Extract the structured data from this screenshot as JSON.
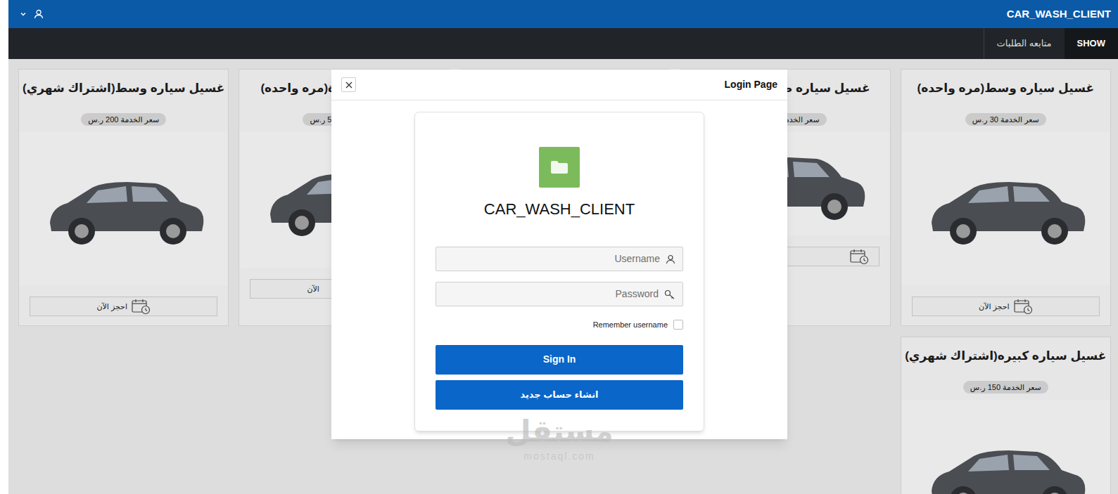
{
  "header": {
    "title": "CAR_WASH_CLIENT"
  },
  "nav": [
    {
      "label": "SHOW",
      "selected": true
    },
    {
      "label": "متابعه الطلبات",
      "selected": false
    }
  ],
  "services": [
    {
      "kind": "full",
      "title": "غسيل سياره وسط(مره واحده)",
      "price": "سعر الخدمة 30 ر.س",
      "button": "احجز الآن"
    },
    {
      "kind": "cut-left",
      "title": "غسيل سياره ص",
      "price": "سعر الخدمة"
    },
    {
      "kind": "hidden"
    },
    {
      "kind": "cut-right",
      "title": "ة(مره واحده)",
      "price": "5 ر.س",
      "button": "الآن"
    },
    {
      "kind": "full",
      "title": "غسيل سياره وسط(اشتراك شهري)",
      "price": "سعر الخدمة 200 ر.س",
      "button": "احجز الآن"
    },
    {
      "kind": "bottom",
      "title": "غسيل سياره كبيره(اشتراك شهري)",
      "price": "سعر الخدمة 150 ر.س"
    }
  ],
  "login": {
    "title": "Login Page",
    "app_name": "CAR_WASH_CLIENT",
    "username_placeholder": "Username",
    "password_placeholder": "Password",
    "remember": {
      "label": "Remember username",
      "checked": false
    },
    "sign_in": "Sign In",
    "register": "انشاء حساب جديد"
  },
  "watermark": {
    "text": "مستقل",
    "sub": "mostaql.com"
  }
}
